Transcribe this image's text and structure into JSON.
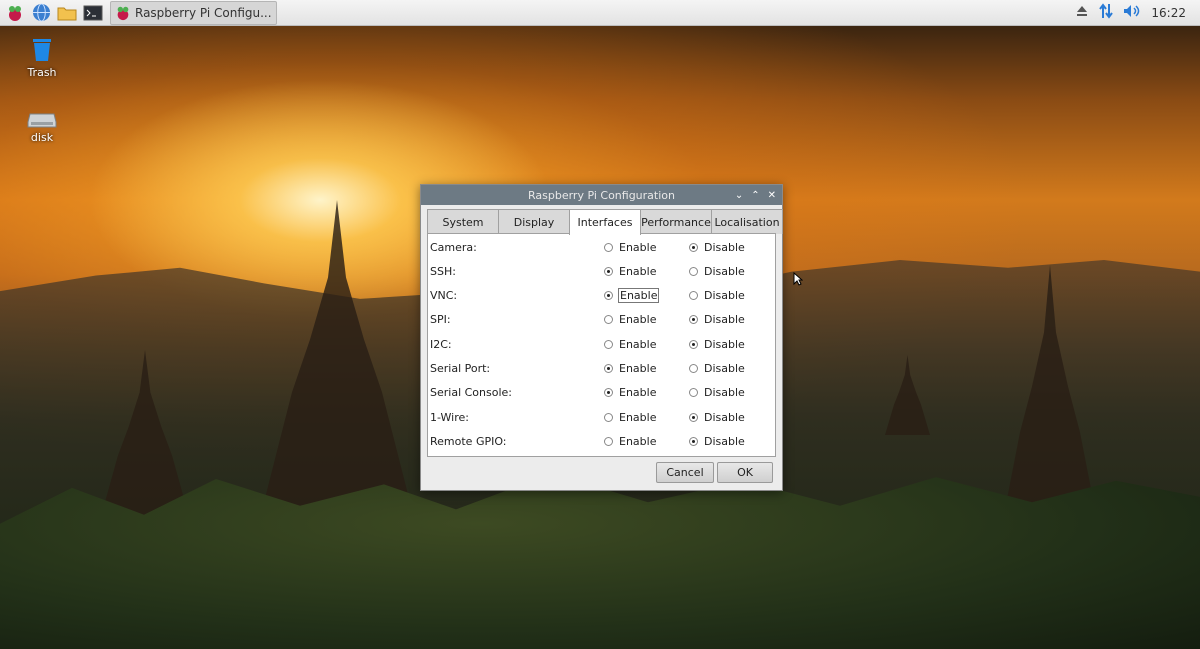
{
  "taskbar": {
    "window_title": "Raspberry Pi Configu...",
    "clock": "16:22",
    "icons": [
      "raspberry-menu-icon",
      "web-browser-icon",
      "file-manager-icon",
      "terminal-icon"
    ],
    "tray_icons": [
      "eject-icon",
      "network-icon",
      "volume-icon"
    ]
  },
  "desktop": {
    "icons": [
      {
        "label": "Trash",
        "icon": "trash-icon"
      },
      {
        "label": "disk",
        "icon": "drive-icon"
      }
    ]
  },
  "dialog": {
    "title": "Raspberry Pi Configuration",
    "tabs": [
      "System",
      "Display",
      "Interfaces",
      "Performance",
      "Localisation"
    ],
    "active_tab": "Interfaces",
    "enable_label": "Enable",
    "disable_label": "Disable",
    "rows": [
      {
        "label": "Camera:",
        "value": "Disable"
      },
      {
        "label": "SSH:",
        "value": "Enable"
      },
      {
        "label": "VNC:",
        "value": "Enable"
      },
      {
        "label": "SPI:",
        "value": "Disable"
      },
      {
        "label": "I2C:",
        "value": "Disable"
      },
      {
        "label": "Serial Port:",
        "value": "Enable"
      },
      {
        "label": "Serial Console:",
        "value": "Enable"
      },
      {
        "label": "1-Wire:",
        "value": "Disable"
      },
      {
        "label": "Remote GPIO:",
        "value": "Disable"
      }
    ],
    "cancel_label": "Cancel",
    "ok_label": "OK"
  }
}
